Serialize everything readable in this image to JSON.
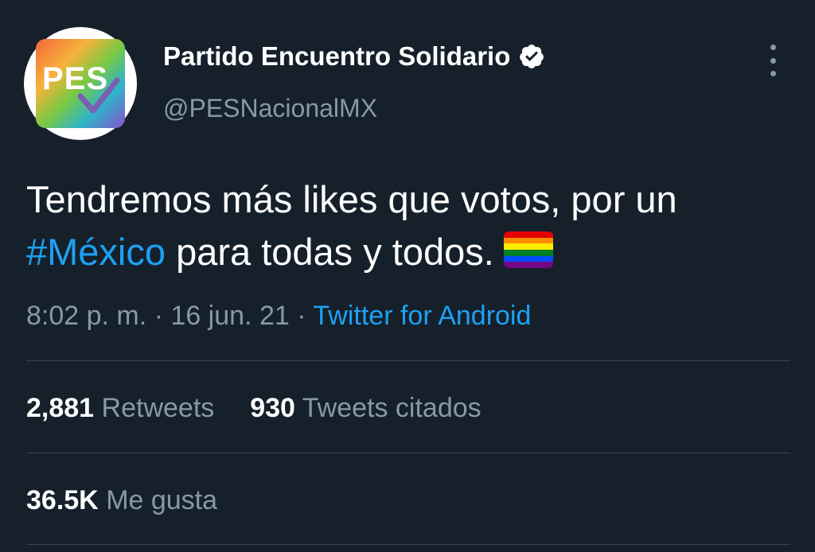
{
  "author": {
    "display_name": "Partido Encuentro Solidario",
    "handle": "@PESNacionalMX",
    "avatar_text": "PES"
  },
  "tweet": {
    "text_before": "Tendremos más likes que votos, por un ",
    "hashtag": "#México",
    "text_after": " para todas y todos.",
    "emoji": "rainbow-flag"
  },
  "meta": {
    "time": "8:02 p. m.",
    "sep1": " · ",
    "date": "16 jun. 21",
    "sep2": " · ",
    "source": "Twitter for Android"
  },
  "stats": {
    "retweets_count": "2,881",
    "retweets_label": "Retweets",
    "quotes_count": "930",
    "quotes_label": "Tweets citados",
    "likes_count": "36.5K",
    "likes_label": "Me gusta"
  },
  "colors": {
    "background": "#15202b",
    "accent": "#1da1f2",
    "secondary_text": "#8899a6"
  }
}
